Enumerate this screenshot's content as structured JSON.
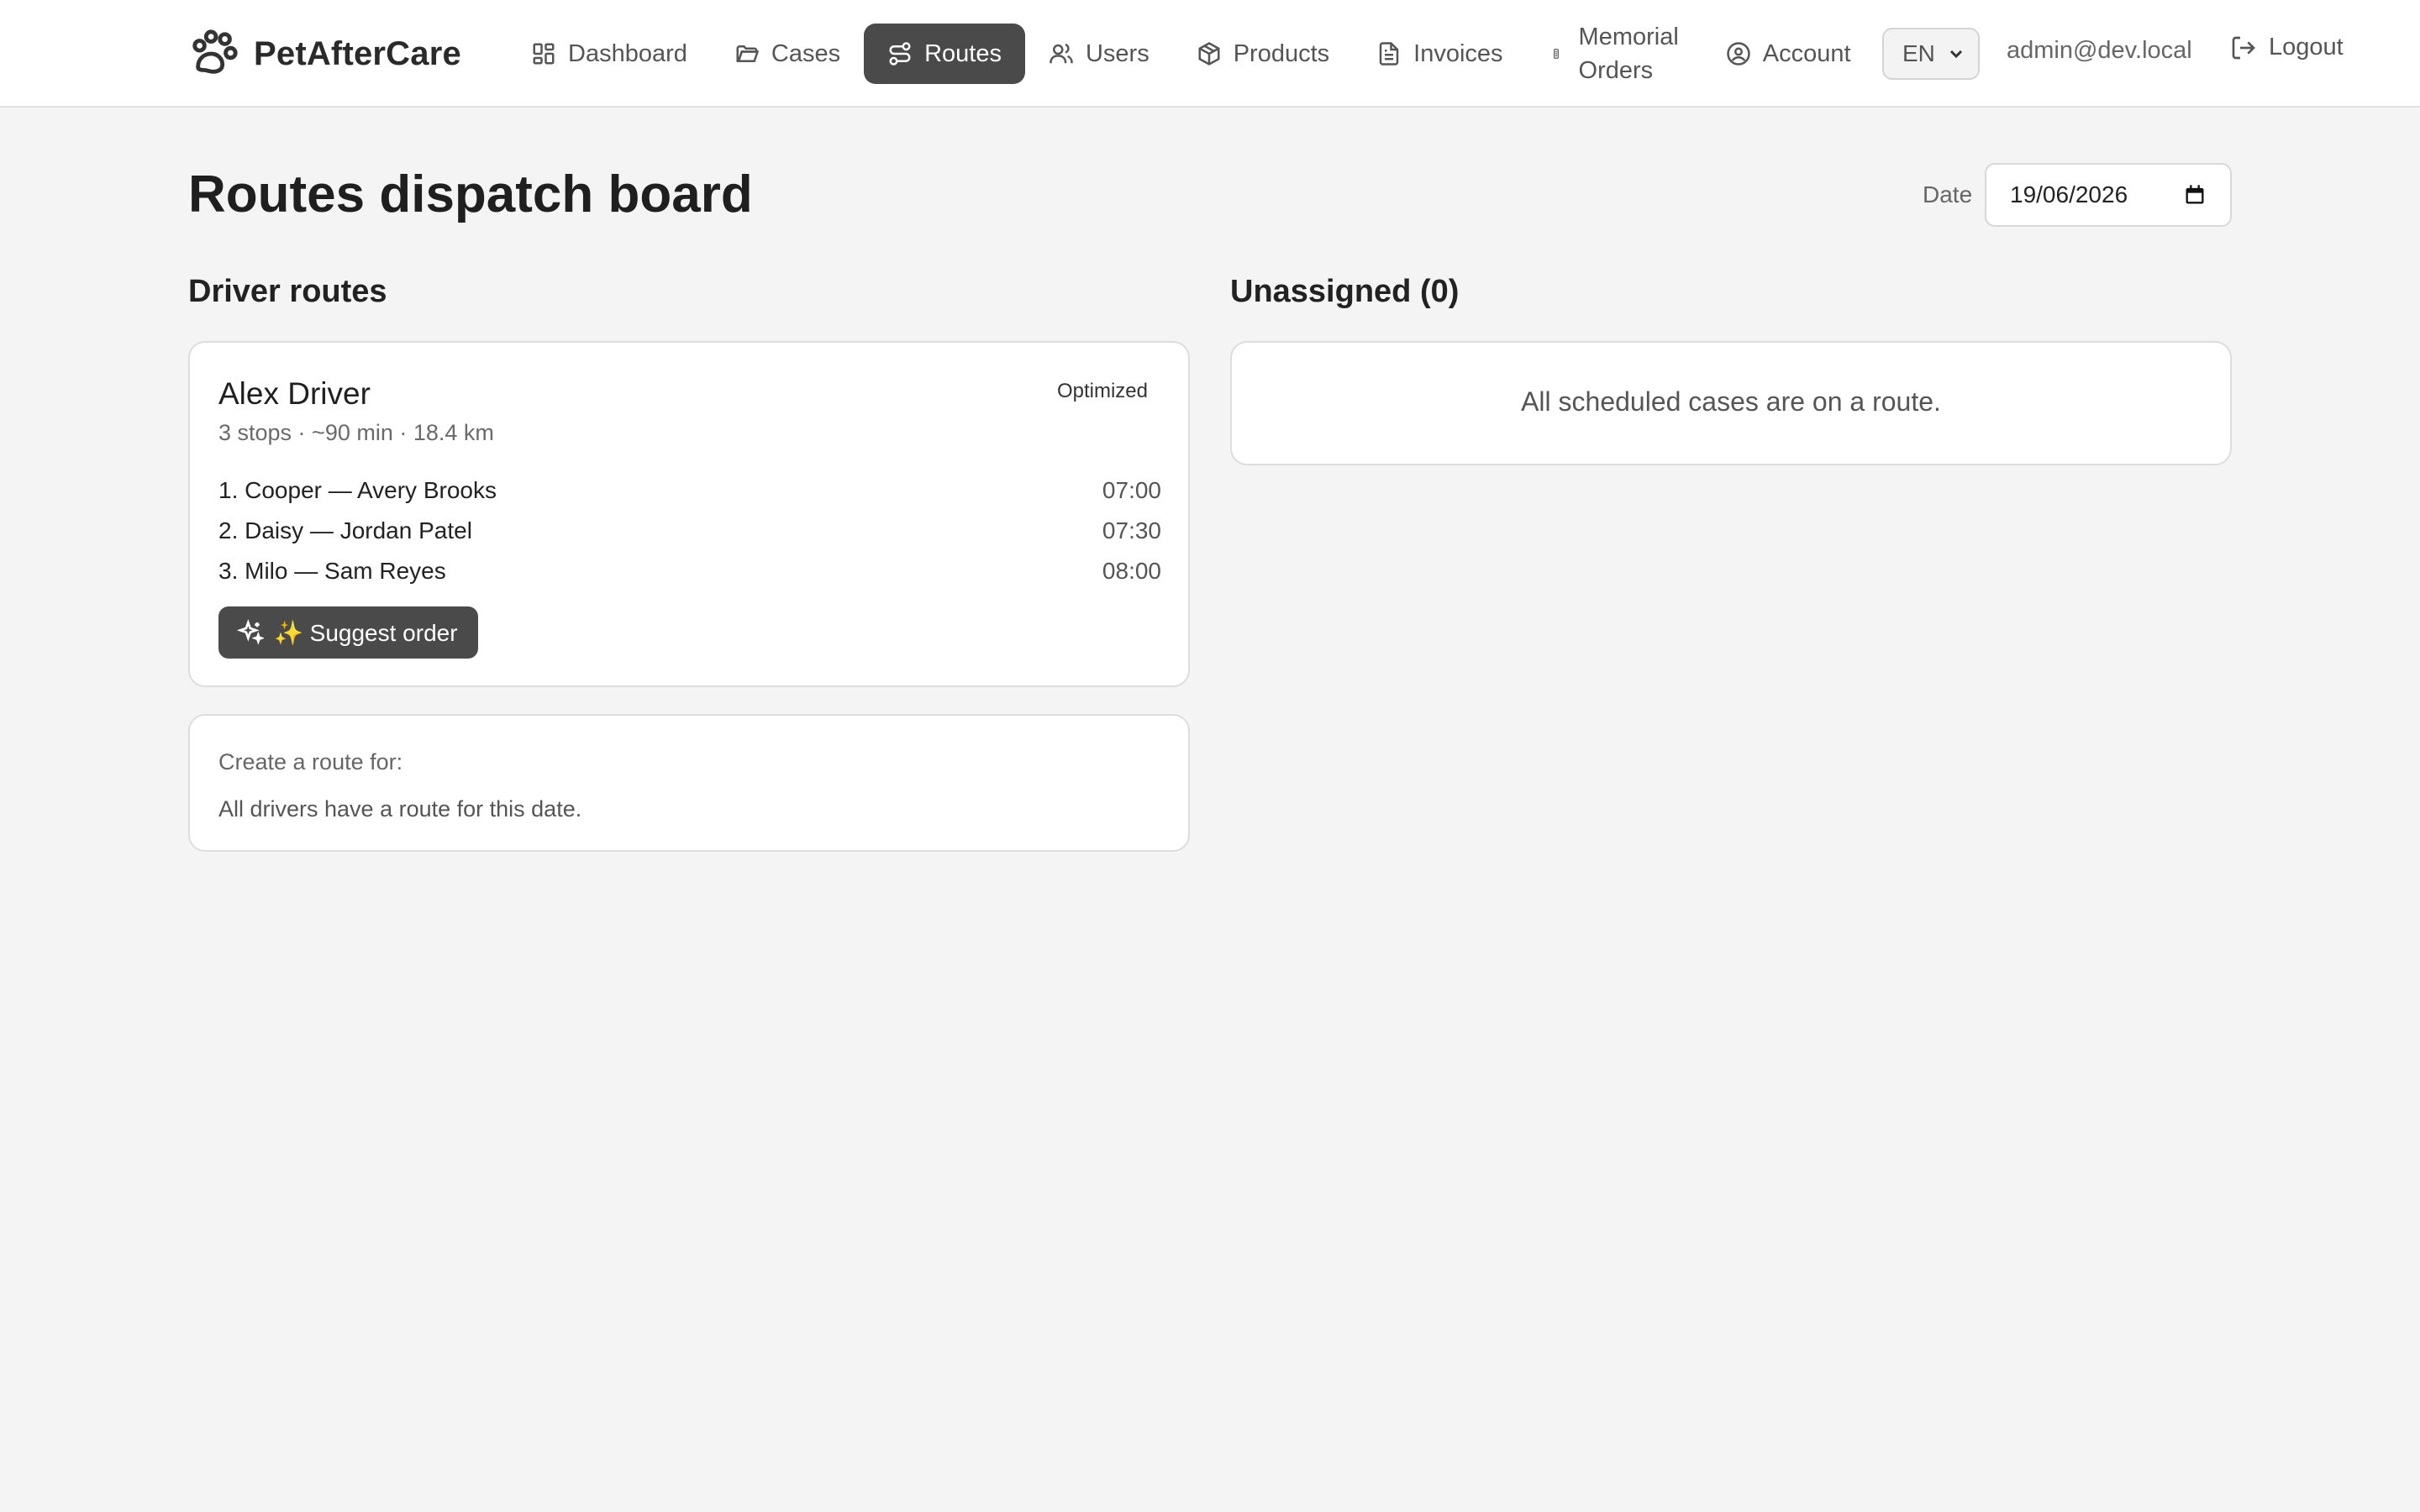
{
  "app": {
    "brand": "PetAfterCare"
  },
  "nav": [
    {
      "label": "Dashboard",
      "icon": "dashboard-icon",
      "active": false
    },
    {
      "label": "Cases",
      "icon": "folder-icon",
      "active": false
    },
    {
      "label": "Routes",
      "icon": "route-icon",
      "active": true
    },
    {
      "label": "Users",
      "icon": "users-icon",
      "active": false
    },
    {
      "label": "Products",
      "icon": "box-icon",
      "active": false
    },
    {
      "label": "Invoices",
      "icon": "document-icon",
      "active": false
    },
    {
      "label_line1": "Memorial",
      "label_line2": "Orders",
      "icon": "memorial-icon",
      "active": false
    },
    {
      "label": "Account",
      "icon": "account-icon",
      "active": false
    }
  ],
  "header": {
    "language": "EN",
    "user_email": "admin@dev.local",
    "logout_label": "Logout"
  },
  "page": {
    "title": "Routes dispatch board",
    "date_label": "Date",
    "date_value": "19/06/2026"
  },
  "driver_routes": {
    "section_title": "Driver routes",
    "routes": [
      {
        "driver": "Alex Driver",
        "meta": "3 stops · ~90 min · 18.4 km",
        "badge": "Optimized",
        "stops": [
          {
            "label": "1. Cooper — Avery Brooks",
            "time": "07:00"
          },
          {
            "label": "2. Daisy — Jordan Patel",
            "time": "07:30"
          },
          {
            "label": "3. Milo — Sam Reyes",
            "time": "08:00"
          }
        ],
        "suggest_label": "✨ Suggest order"
      }
    ],
    "create": {
      "label": "Create a route for:",
      "message": "All drivers have a route for this date."
    }
  },
  "unassigned": {
    "section_title": "Unassigned (0)",
    "empty_message": "All scheduled cases are on a route."
  },
  "colors": {
    "background": "#f4f4f4",
    "active_nav": "#4a4a4a",
    "card": "#ffffff",
    "border": "#dddddd"
  }
}
